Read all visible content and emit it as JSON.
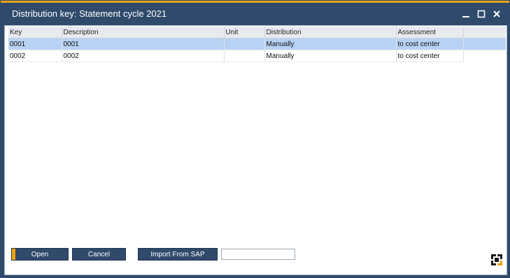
{
  "window": {
    "title": "Distribution key: Statement cycle 2021"
  },
  "titlebar_buttons": {
    "minimize": "minimize-icon",
    "maximize": "maximize-icon",
    "close": "close-icon"
  },
  "table": {
    "columns": [
      "Key",
      "Description",
      "Unit",
      "Distribution",
      "Assessment"
    ],
    "rows": [
      {
        "key": "0001",
        "description": "0001",
        "unit": "",
        "distribution": "Manually",
        "assessment": "to cost center",
        "selected": true
      },
      {
        "key": "0002",
        "description": "0002",
        "unit": "",
        "distribution": "Manually",
        "assessment": "to cost center",
        "selected": false
      }
    ]
  },
  "buttons": {
    "open": "Open",
    "cancel": "Cancel",
    "import": "Import From SAP"
  },
  "import_field": {
    "value": ""
  },
  "colors": {
    "window_frame": "#2f4a6b",
    "accent": "#e8a317",
    "selection": "#b7d2f3",
    "button_bg": "#2f4a6b",
    "open_marker": "#f0a30a"
  },
  "icons": {
    "corner_logo": "sap-business-one-logo-icon"
  }
}
